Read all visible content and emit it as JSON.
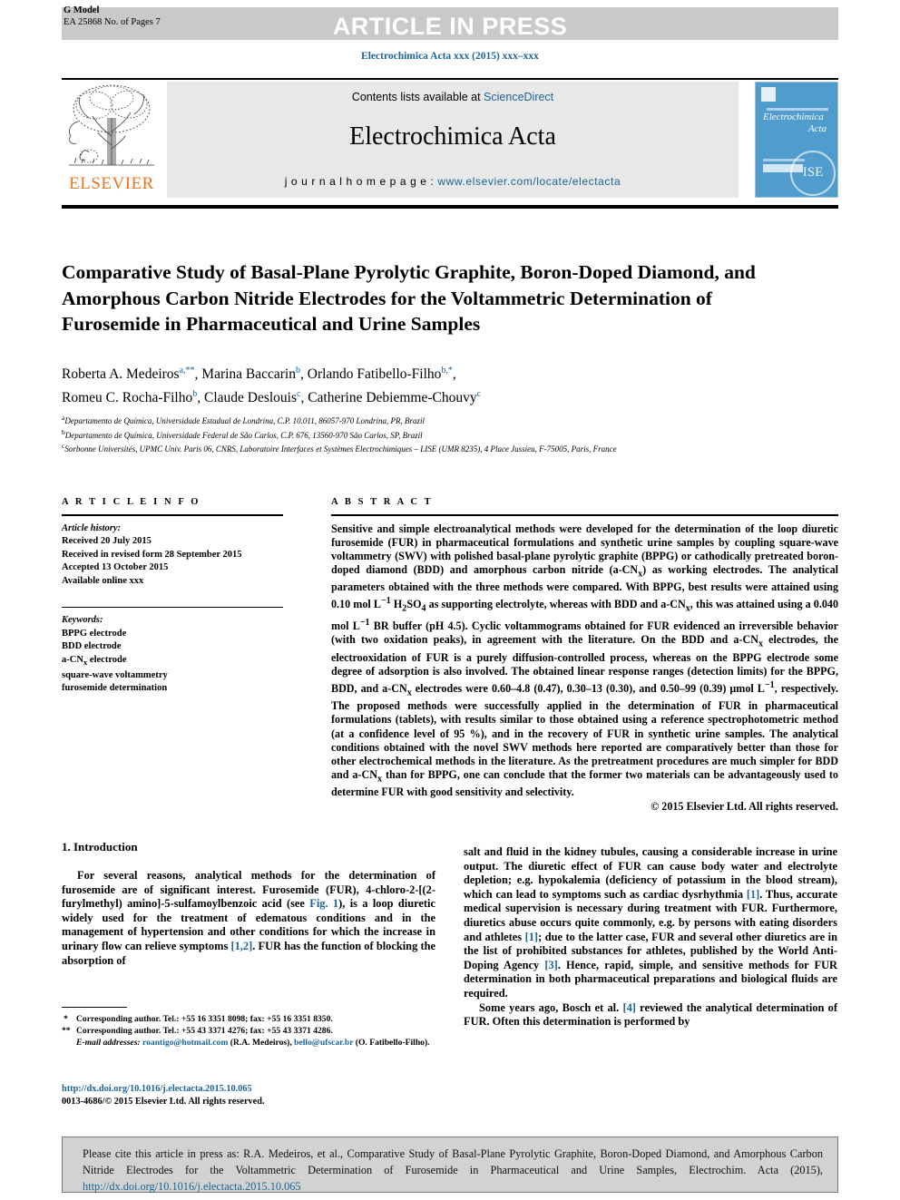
{
  "header": {
    "g_model_line1": "G Model",
    "g_model_line2": "EA 25868 No. of Pages 7",
    "article_in_press": "ARTICLE IN PRESS",
    "journal_ref": "Electrochimica Acta xxx (2015) xxx–xxx"
  },
  "masthead": {
    "contents_prefix": "Contents lists available at ",
    "sciencedirect": "ScienceDirect",
    "journal_title": "Electrochimica Acta",
    "homepage_label": "j o u r n a l  h o m e p a g e :  ",
    "homepage_url": "www.elsevier.com/locate/electacta",
    "publisher": "ELSEVIER",
    "cover_title_line1": "Electrochimica",
    "cover_title_line2": "Acta",
    "cover_ise": "ISE"
  },
  "article": {
    "title": "Comparative Study of Basal-Plane Pyrolytic Graphite, Boron-Doped Diamond, and Amorphous Carbon Nitride Electrodes for the Voltammetric Determination of Furosemide in Pharmaceutical and Urine Samples",
    "authors_line1_parts": [
      {
        "name": "Roberta A. Medeiros",
        "sup": "a,**"
      },
      {
        "name": "Marina Baccarin",
        "sup": "b"
      },
      {
        "name": "Orlando Fatibello-Filho",
        "sup": "b,*"
      }
    ],
    "authors_line2_parts": [
      {
        "name": "Romeu C. Rocha-Filho",
        "sup": "b"
      },
      {
        "name": "Claude Deslouis",
        "sup": "c"
      },
      {
        "name": "Catherine Debiemme-Chouvy",
        "sup": "c"
      }
    ],
    "affiliations": [
      {
        "mark": "a",
        "text": "Departamento de Química, Universidade Estadual de Londrina, C.P. 10.011, 86057-970 Londrina, PR, Brazil"
      },
      {
        "mark": "b",
        "text": "Departamento de Química, Universidade Federal de São Carlos, C.P. 676, 13560-970 São Carlos, SP, Brazil"
      },
      {
        "mark": "c",
        "text": "Sorbonne Universités, UPMC Univ. Paris 06, CNRS, Laboratoire Interfaces et Systèmes Electrochimiques – LISE (UMR 8235), 4 Place Jussieu, F-75005, Paris, France"
      }
    ]
  },
  "article_info": {
    "heading": "A R T I C L E  I N F O",
    "history_title": "Article history:",
    "history": [
      "Received 20 July 2015",
      "Received in revised form 28 September 2015",
      "Accepted 13 October 2015",
      "Available online xxx"
    ],
    "keywords_title": "Keywords:",
    "keywords": [
      "BPPG electrode",
      "BDD electrode",
      "a-CNx electrode",
      "square-wave voltammetry",
      "furosemide determination"
    ]
  },
  "abstract": {
    "heading": "A B S T R A C T",
    "text": "Sensitive and simple electroanalytical methods were developed for the determination of the loop diuretic furosemide (FUR) in pharmaceutical formulations and synthetic urine samples by coupling square-wave voltammetry (SWV) with polished basal-plane pyrolytic graphite (BPPG) or cathodically pretreated boron-doped diamond (BDD) and amorphous carbon nitride (a-CNx) as working electrodes. The analytical parameters obtained with the three methods were compared. With BPPG, best results were attained using 0.10 mol L−1 H2SO4 as supporting electrolyte, whereas with BDD and a-CNx, this was attained using a 0.040 mol L−1 BR buffer (pH 4.5). Cyclic voltammograms obtained for FUR evidenced an irreversible behavior (with two oxidation peaks), in agreement with the literature. On the BDD and a-CNx electrodes, the electrooxidation of FUR is a purely diffusion-controlled process, whereas on the BPPG electrode some degree of adsorption is also involved. The obtained linear response ranges (detection limits) for the BPPG, BDD, and a-CNx electrodes were 0.60–4.8 (0.47), 0.30–13 (0.30), and 0.50–99 (0.39) μmol L−1, respectively. The proposed methods were successfully applied in the determination of FUR in pharmaceutical formulations (tablets), with results similar to those obtained using a reference spectrophotometric method (at a confidence level of 95 %), and in the recovery of FUR in synthetic urine samples. The analytical conditions obtained with the novel SWV methods here reported are comparatively better than those for other electrochemical methods in the literature. As the pretreatment procedures are much simpler for BDD and a-CNx than for BPPG, one can conclude that the former two materials can be advantageously used to determine FUR with good sensitivity and selectivity.",
    "copyright": "© 2015 Elsevier Ltd. All rights reserved."
  },
  "introduction": {
    "heading": "1. Introduction",
    "left_paragraph": "For several reasons, analytical methods for the determination of furosemide are of significant interest. Furosemide (FUR), 4-chloro-2-[(2-furylmethyl) amino]-5-sulfamoylbenzoic acid (see Fig. 1), is a loop diuretic widely used for the treatment of edematous conditions and in the management of hypertension and other conditions for which the increase in urinary flow can relieve symptoms [1,2]. FUR has the function of blocking the absorption of",
    "right_paragraph_1": "salt and fluid in the kidney tubules, causing a considerable increase in urine output. The diuretic effect of FUR can cause body water and electrolyte depletion; e.g. hypokalemia (deficiency of potassium in the blood stream), which can lead to symptoms such as cardiac dysrhythmia [1]. Thus, accurate medical supervision is necessary during treatment with FUR. Furthermore, diuretics abuse occurs quite commonly, e.g. by persons with eating disorders and athletes [1]; due to the latter case, FUR and several other diuretics are in the list of prohibited substances for athletes, published by the World Anti-Doping Agency [3]. Hence, rapid, simple, and sensitive methods for FUR determination in both pharmaceutical preparations and biological fluids are required.",
    "right_paragraph_2": "Some years ago, Bosch et al. [4] reviewed the analytical determination of FUR. Often this determination is performed by",
    "link_fig1": "Fig. 1",
    "link_ref12": "[1,2]",
    "link_ref1": "[1]",
    "link_ref3": "[3]",
    "link_ref4": "[4]"
  },
  "footnotes": {
    "corresponding_1": "Corresponding author. Tel.: +55 16 3351 8098; fax: +55 16 3351 8350.",
    "corresponding_2": "Corresponding author. Tel.: +55 43 3371 4276; fax: +55 43 3371 4286.",
    "email_label": "E-mail addresses:",
    "email_1": "roantigo@hotmail.com",
    "email_1_owner": "(R.A. Medeiros),",
    "email_2": "bello@ufscar.br",
    "email_2_owner": "(O. Fatibello-Filho).",
    "doi": "http://dx.doi.org/10.1016/j.electacta.2015.10.065",
    "issn_line": "0013-4686/© 2015 Elsevier Ltd. All rights reserved."
  },
  "cite_box": {
    "text": "Please cite this article in press as: R.A. Medeiros, et al., Comparative Study of Basal-Plane Pyrolytic Graphite, Boron-Doped Diamond, and Amorphous Carbon Nitride Electrodes for the Voltammetric Determination of Furosemide in Pharmaceutical and Urine Samples, Electrochim. Acta (2015), ",
    "link": "http://dx.doi.org/10.1016/j.electacta.2015.10.065"
  },
  "colors": {
    "link": "#1a6496",
    "banner_gray": "#c9c9c9",
    "masthead_gray": "#e8e8e8",
    "elsevier_orange": "#E87722",
    "cover_blue": "#4f9ccd",
    "cite_gray": "#d2d2d2"
  }
}
